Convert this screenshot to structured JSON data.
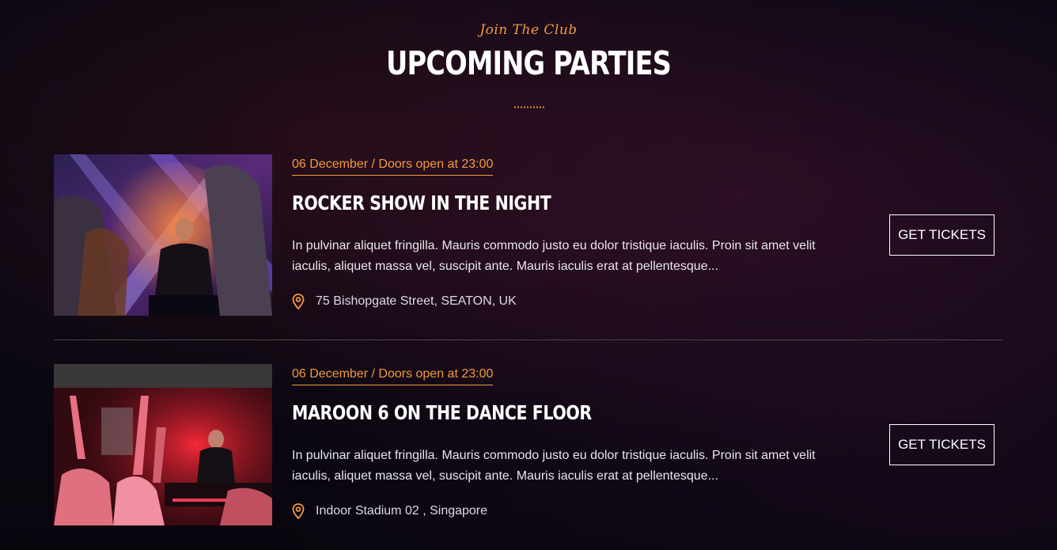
{
  "header": {
    "subtitle": "Join The Club",
    "title": "UPCOMING PARTIES"
  },
  "events": [
    {
      "date": "06 December / Doors open at 23:00",
      "title": "ROCKER SHOW IN THE NIGHT",
      "description": "In pulvinar aliquet fringilla. Mauris commodo justo eu dolor tristique iaculis. Proin sit amet velit iaculis, aliquet massa vel, suscipit ante. Mauris iaculis erat at pellentesque...",
      "location": "75 Bishopgate Street, SEATON, UK",
      "button_label": "GET TICKETS"
    },
    {
      "date": "06 December / Doors open at 23:00",
      "title": "MAROON 6 ON THE DANCE FLOOR",
      "description": "In pulvinar aliquet fringilla. Mauris commodo justo eu dolor tristique iaculis. Proin sit amet velit iaculis, aliquet massa vel, suscipit ante. Mauris iaculis erat at pellentesque...",
      "location": "Indoor Stadium 02 , Singapore",
      "button_label": "GET TICKETS"
    }
  ],
  "colors": {
    "accent": "#f29a3f",
    "background": "#0d0b1a",
    "text": "#ffffff"
  },
  "icons": {
    "location": "map-pin-icon"
  }
}
